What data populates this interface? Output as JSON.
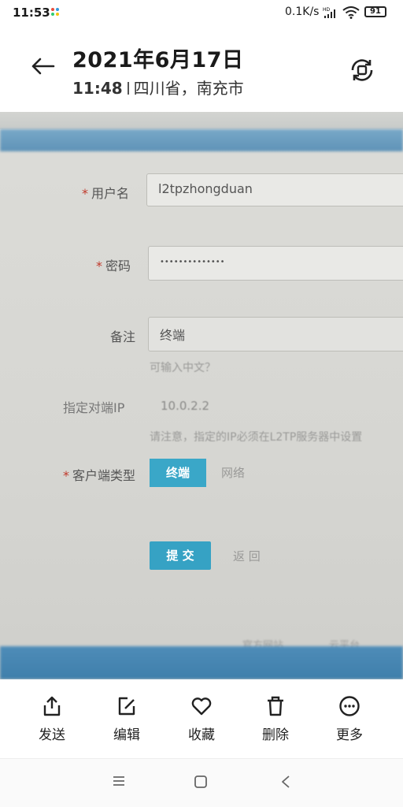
{
  "status_bar": {
    "time": "11:53",
    "net_speed": "0.1K/s",
    "battery": "91",
    "icons": [
      "notification-icon",
      "hd-signal-icon",
      "wifi-icon",
      "battery-icon"
    ]
  },
  "header": {
    "date": "2021年6月17日",
    "time": "11:48",
    "location": "四川省，南充市",
    "icons": [
      "back-arrow-icon",
      "rotate-sync-icon"
    ]
  },
  "photo": {
    "form": {
      "username_label": "用户名",
      "username_value": "l2tpzhongduan",
      "password_label": "密码",
      "password_value": "••••••••••••••",
      "remark_label": "备注",
      "remark_value": "终端",
      "remark_hint": "可输入中文？",
      "peer_ip_label": "指定对端IP",
      "peer_ip_value": "10.0.2.2",
      "peer_ip_hint": "请注意，指定的IP必须在L2TP服务器中设置",
      "client_type_label": "客户端类型",
      "client_type_options": [
        "终端",
        "网络"
      ],
      "client_type_selected": "终端",
      "submit_label": "提 交",
      "back_label": "返 回"
    },
    "footer_links": [
      "官方网站",
      "云平台"
    ],
    "colors": {
      "accent": "#3aa7c8",
      "top_bar": "#5f93b7",
      "required": "#c0392b"
    }
  },
  "actions": [
    {
      "label": "发送",
      "icon": "share-icon"
    },
    {
      "label": "编辑",
      "icon": "edit-icon"
    },
    {
      "label": "收藏",
      "icon": "heart-icon"
    },
    {
      "label": "删除",
      "icon": "trash-icon"
    },
    {
      "label": "更多",
      "icon": "more-icon"
    }
  ],
  "nav_bar": {
    "icons": [
      "menu-icon",
      "home-icon",
      "back-icon"
    ]
  }
}
